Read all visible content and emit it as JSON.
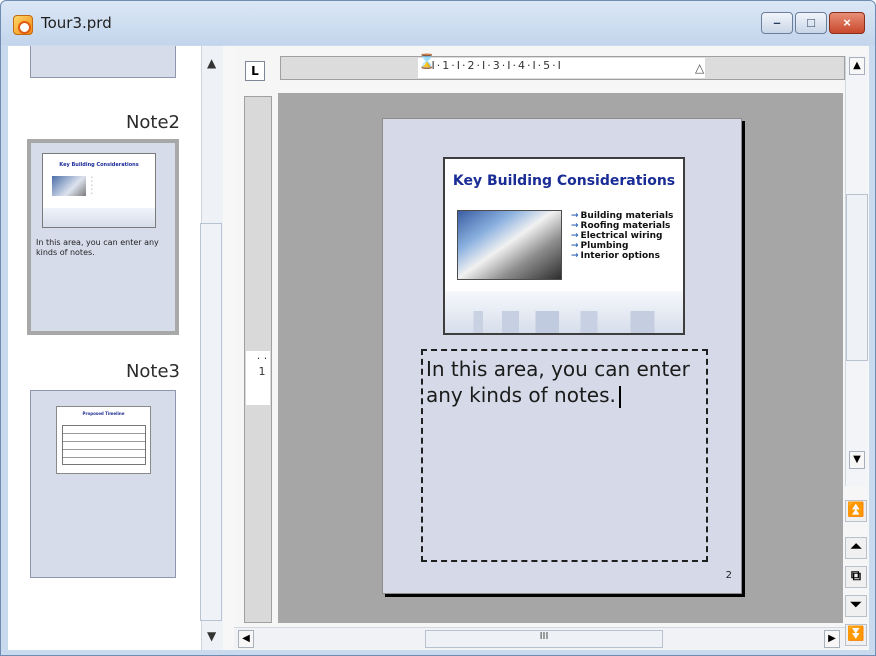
{
  "window": {
    "title": "Tour3.prd",
    "minimize": "–",
    "restore": "□",
    "close": "×"
  },
  "slides_panel": {
    "items": [
      {
        "label": "Note2",
        "mini_title": "Key Building Considerations",
        "note": "In this area, you can enter any kinds of notes."
      },
      {
        "label": "Note3",
        "mini_title": "Proposed Timeline"
      }
    ],
    "scroll_up": "▲",
    "scroll_down": "▼"
  },
  "editor": {
    "tab_stop": "L",
    "ruler": "·I·1·I·2·I·3·I·4·I·5·I",
    "vertical_ruler": "·\n·\n1",
    "slide": {
      "title": "Key Building Considerations",
      "bullets": [
        "Building materials",
        "Roofing materials",
        "Electrical wiring",
        "Plumbing",
        "Interior options"
      ]
    },
    "notes": "In this area, you can enter any kinds of notes.",
    "page_number": "2",
    "scroll_up": "▲",
    "scroll_down": "▼",
    "nav_buttons": [
      "⏫",
      "⏶",
      "⧉",
      "⏷",
      "⏬"
    ],
    "hscroll_grip": "III",
    "hscroll_left": "◀",
    "hscroll_right": "▶"
  }
}
